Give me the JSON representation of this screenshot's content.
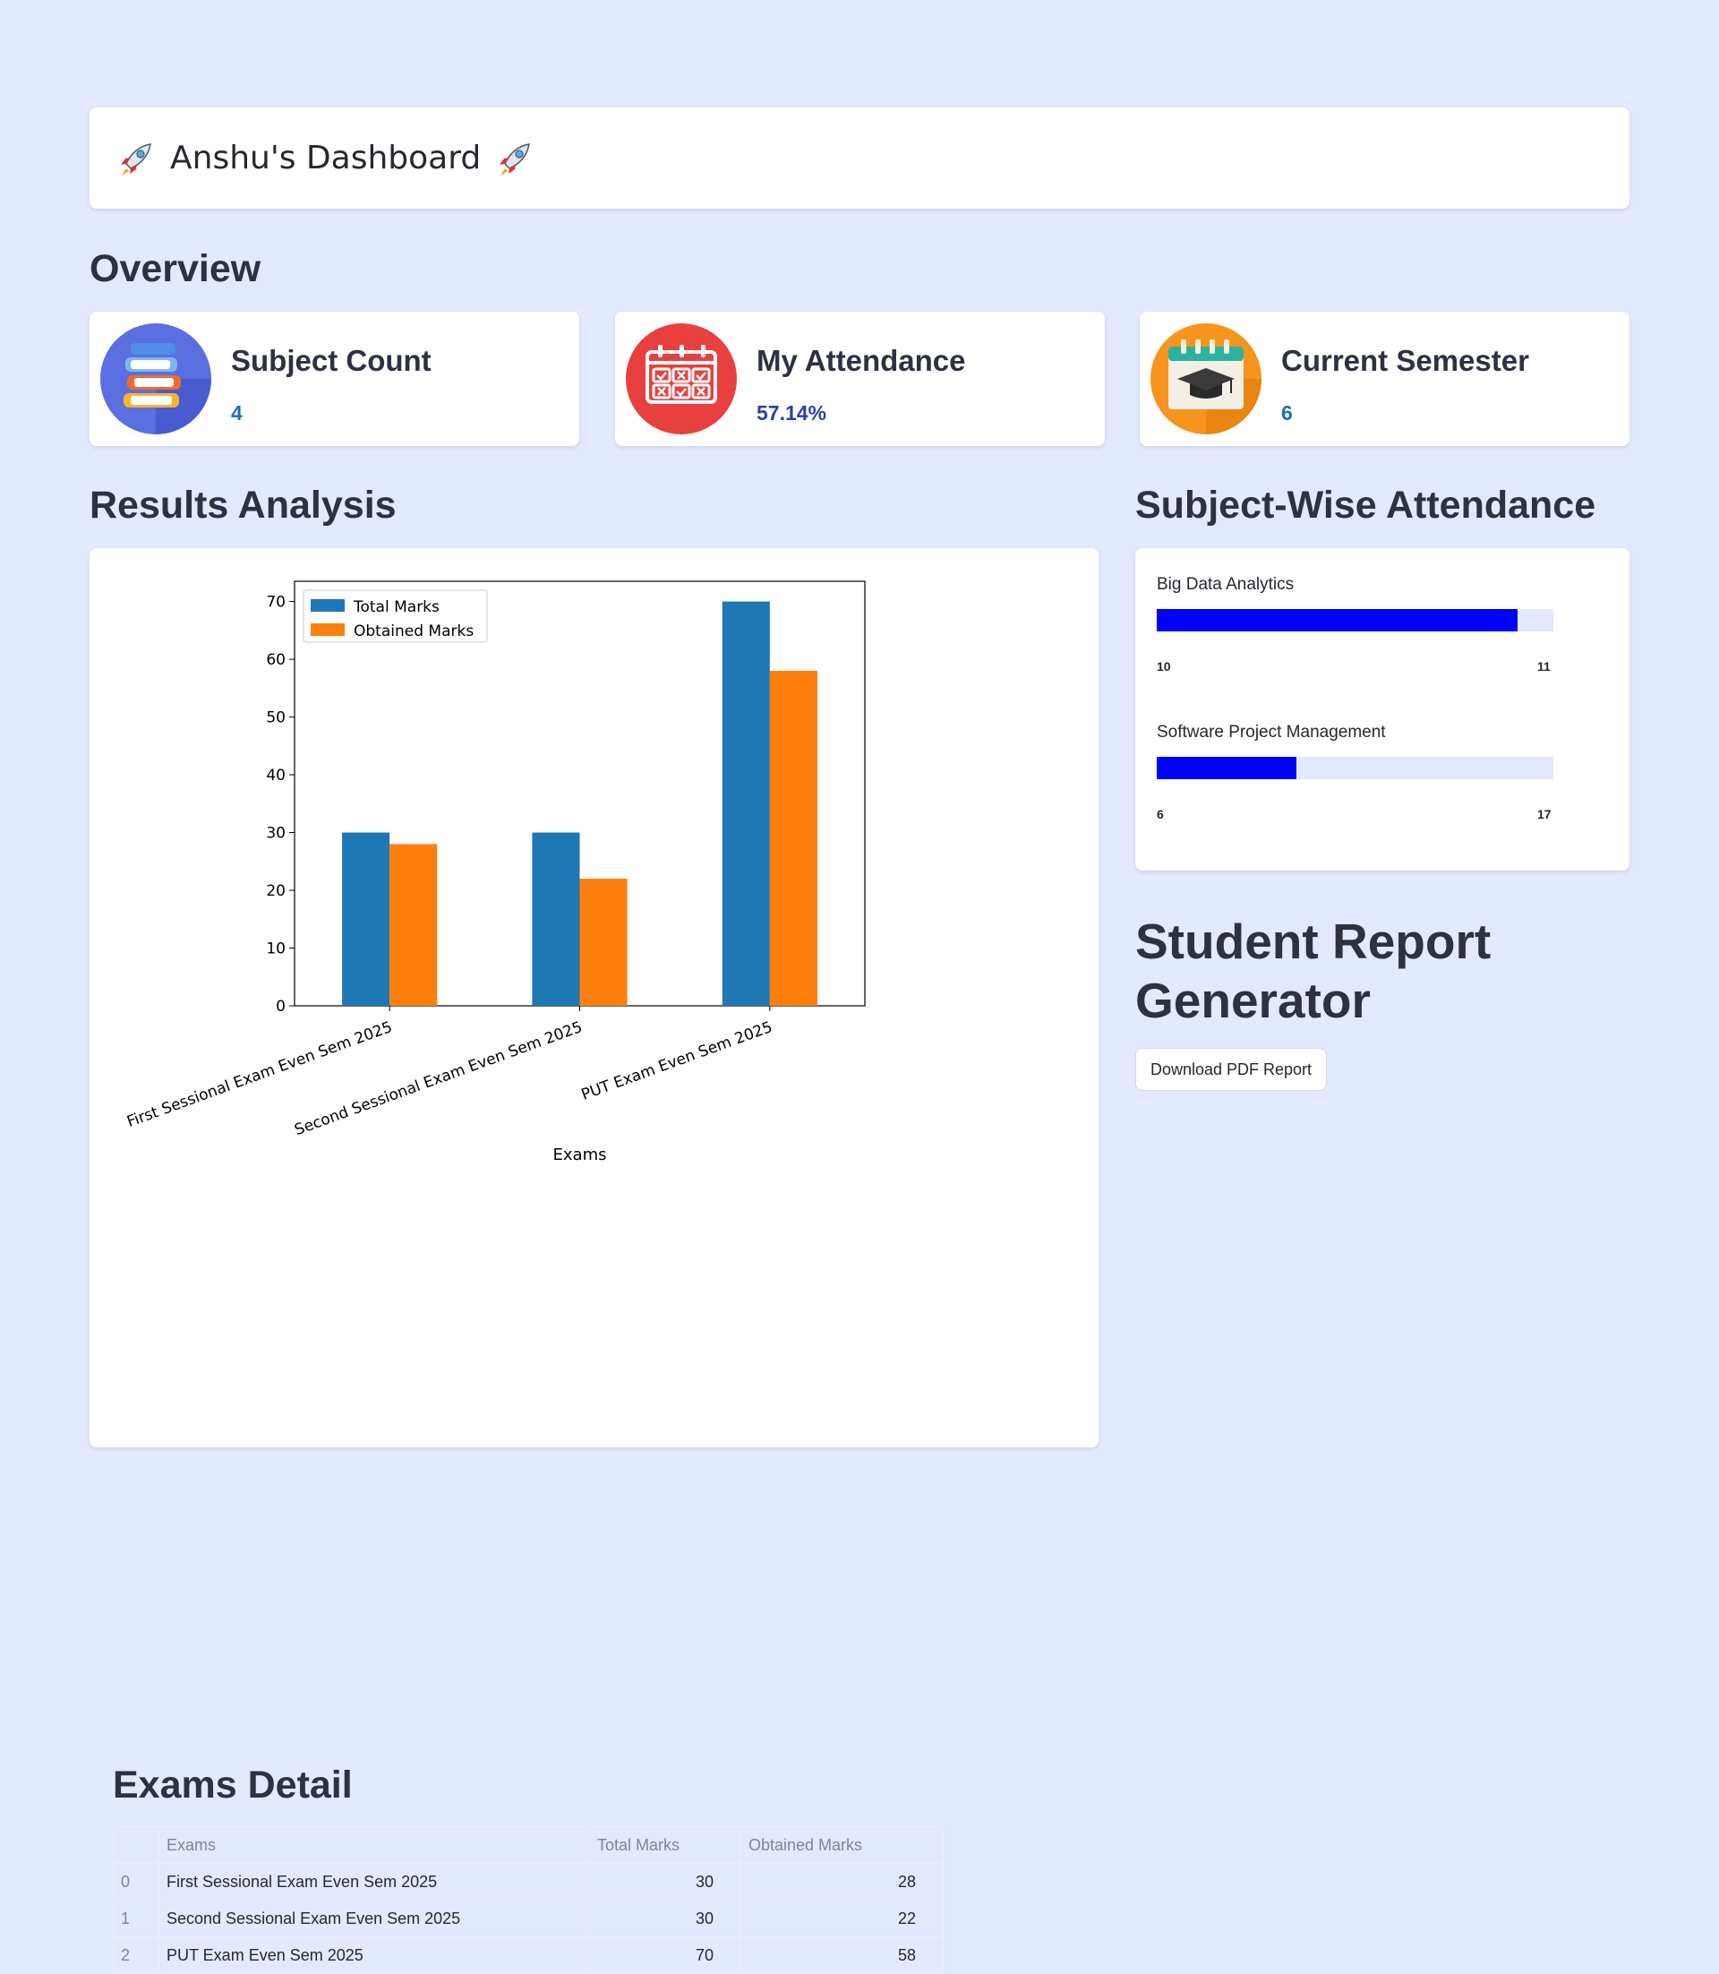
{
  "header": {
    "title": "Anshu's Dashboard"
  },
  "overview": {
    "heading": "Overview",
    "metrics": [
      {
        "label": "Subject Count",
        "value": "4",
        "icon": "books-icon"
      },
      {
        "label": "My Attendance",
        "value": "57.14%",
        "icon": "calendar-icon"
      },
      {
        "label": "Current Semester",
        "value": "6",
        "icon": "graduation-cap-icon"
      }
    ]
  },
  "results": {
    "heading": "Results Analysis"
  },
  "chart_data": {
    "type": "bar",
    "categories": [
      "First Sessional Exam Even Sem 2025",
      "Second Sessional Exam Even Sem 2025",
      "PUT Exam Even Sem 2025"
    ],
    "series": [
      {
        "name": "Total Marks",
        "values": [
          30,
          30,
          70
        ],
        "color": "#1f77b4"
      },
      {
        "name": "Obtained Marks",
        "values": [
          28,
          22,
          58
        ],
        "color": "#ff7f0e"
      }
    ],
    "xlabel": "Exams",
    "ylabel": "",
    "ylim": [
      0,
      73.5
    ],
    "yticks": [
      0,
      10,
      20,
      30,
      40,
      50,
      60,
      70
    ],
    "legend": "top-left",
    "grid": false
  },
  "exams_detail": {
    "heading": "Exams Detail",
    "columns": [
      "",
      "Exams",
      "Total Marks",
      "Obtained Marks"
    ],
    "rows": [
      {
        "index": "0",
        "exam": "First Sessional Exam Even Sem 2025",
        "total": "30",
        "obtained": "28"
      },
      {
        "index": "1",
        "exam": "Second Sessional Exam Even Sem 2025",
        "total": "30",
        "obtained": "22"
      },
      {
        "index": "2",
        "exam": "PUT Exam Even Sem 2025",
        "total": "70",
        "obtained": "58"
      }
    ]
  },
  "attendance": {
    "heading": "Subject-Wise Attendance",
    "subjects": [
      {
        "name": "Big Data Analytics",
        "attended": "10",
        "total": "11",
        "fraction": 0.909
      },
      {
        "name": "Software Project Management",
        "attended": "6",
        "total": "17",
        "fraction": 0.353
      }
    ],
    "bar_color": "#0000ff"
  },
  "report": {
    "heading": "Student Report Generator",
    "button_label": "Download PDF Report"
  }
}
